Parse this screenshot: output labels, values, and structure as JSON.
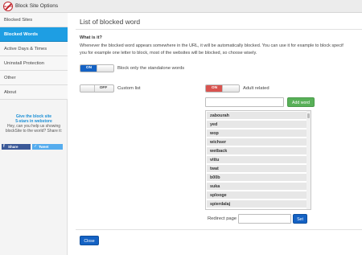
{
  "app": {
    "title": "Block Site Options",
    "logo_text": "BLOCK"
  },
  "sidebar": {
    "items": [
      {
        "label": "Blocked Sites",
        "active": false
      },
      {
        "label": "Blocked Words",
        "active": true
      },
      {
        "label": "Active Days & Times",
        "active": false
      },
      {
        "label": "Uninstall Protection",
        "active": false
      },
      {
        "label": "Other",
        "active": false
      },
      {
        "label": "About",
        "active": false
      }
    ],
    "promo_title_1": "Give the block site",
    "promo_title_2": "5-stars in webstore",
    "promo_text_1": "Hey, can you help us showing",
    "promo_text_2": "blockSite to the world? Share it:",
    "share_facebook": "Share",
    "share_twitter": "Tweet"
  },
  "main": {
    "title": "List of blocked word",
    "what_heading": "What is it?",
    "desc_line1": "Whenever the blocked word appears somewhere in the URL, it will be automatically blocked. You can use it for example to block specif",
    "desc_line2": "you for example one letter to block, most of the websites will be blocked, so choose wisely.",
    "standalone": {
      "state": "ON",
      "label": "Block only the standalone words"
    },
    "custom_list": {
      "state": "OFF",
      "label": "Custom list"
    },
    "adult_related": {
      "state": "ON",
      "label": "Adult related"
    },
    "add_word_input": {
      "value": "",
      "placeholder": ""
    },
    "add_word_button": "Add word",
    "words": [
      "zabourah",
      "yed",
      "wop",
      "wichser",
      "wetback",
      "vittu",
      "twat",
      "b00b",
      "suka",
      "splooge",
      "spierdalaj"
    ],
    "redirect_label": "Redirect page",
    "redirect_input": {
      "value": "",
      "placeholder": ""
    },
    "set_button": "Set",
    "close_button": "Close"
  },
  "colors": {
    "accent_blue": "#1e9ee3",
    "button_blue": "#1462c4",
    "toggle_red": "#d9534f",
    "add_green": "#58b058",
    "facebook": "#3b5998",
    "twitter": "#55acee"
  }
}
